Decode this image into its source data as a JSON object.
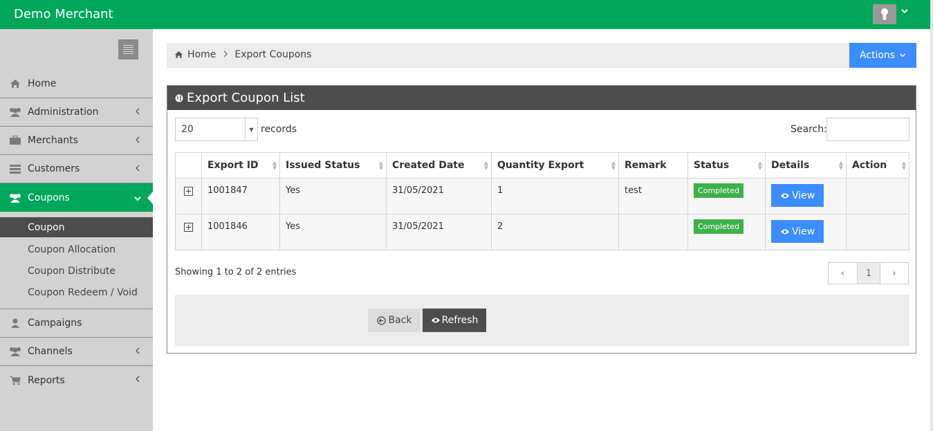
{
  "app": {
    "brand": "Demo Merchant"
  },
  "colors": {
    "primary_green": "#00a65a",
    "accent_blue": "#3c8dfe",
    "dark": "#4d4d4d",
    "sidebar_bg": "#d2d2d2",
    "badge_green": "#3cb14a"
  },
  "sidebar": {
    "items": [
      {
        "label": "Home",
        "icon": "home-icon"
      },
      {
        "label": "Administration",
        "icon": "users-icon"
      },
      {
        "label": "Merchants",
        "icon": "briefcase-icon"
      },
      {
        "label": "Customers",
        "icon": "list-icon"
      },
      {
        "label": "Coupons",
        "icon": "users-icon"
      },
      {
        "label": "Campaigns",
        "icon": "user-icon"
      },
      {
        "label": "Channels",
        "icon": "users-icon"
      },
      {
        "label": "Reports",
        "icon": "cart-icon"
      }
    ],
    "coupons_submenu": [
      "Coupon",
      "Coupon Allocation",
      "Coupon Distribute",
      "Coupon Redeem / Void"
    ]
  },
  "breadcrumb": {
    "home": "Home",
    "current": "Export Coupons"
  },
  "actions_label": "Actions",
  "panel": {
    "title": "Export Coupon List",
    "length_value": "20",
    "length_label": "records",
    "search_label": "Search:",
    "search_value": ""
  },
  "table": {
    "headers": [
      "Export ID",
      "Issued Status",
      "Created Date",
      "Quantity Export",
      "Remark",
      "Status",
      "Details",
      "Action"
    ],
    "rows": [
      {
        "export_id": "1001847",
        "issued_status": "Yes",
        "created_date": "31/05/2021",
        "quantity": "1",
        "remark": "test",
        "status": "Completed",
        "details": "View",
        "action": ""
      },
      {
        "export_id": "1001846",
        "issued_status": "Yes",
        "created_date": "31/05/2021",
        "quantity": "2",
        "remark": "",
        "status": "Completed",
        "details": "View",
        "action": ""
      }
    ]
  },
  "info_text": "Showing 1 to 2 of 2 entries",
  "pager": {
    "prev": "‹",
    "current": "1",
    "next": "›"
  },
  "buttons": {
    "back": "Back",
    "refresh": "Refresh"
  }
}
